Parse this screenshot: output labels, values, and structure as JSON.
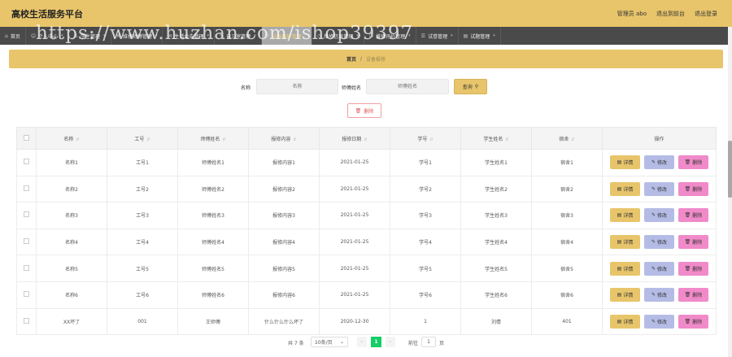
{
  "header": {
    "title": "高校生活服务平台",
    "admin": "管理员 abo",
    "back_home": "退出到前台",
    "logout": "退出登录"
  },
  "nav": [
    {
      "icon": "home-icon",
      "label": "首页",
      "active": false
    },
    {
      "icon": "user-icon",
      "label": "个人中心",
      "active": false
    },
    {
      "icon": "student-icon",
      "label": "学生管理",
      "active": false
    },
    {
      "icon": "worker-icon",
      "label": "维修师傅管理",
      "active": false
    },
    {
      "icon": "notice-icon",
      "label": "生活公告管理",
      "active": false
    },
    {
      "icon": "post-icon",
      "label": "自习室管理",
      "active": false
    },
    {
      "icon": "mic-icon",
      "label": "设备报修管理",
      "active": true
    },
    {
      "icon": "clock-icon",
      "label": "维修信息管理",
      "active": false
    },
    {
      "icon": "comment-icon",
      "label": "维修评价管理",
      "active": false
    },
    {
      "icon": "exam-icon",
      "label": "试卷管理",
      "active": false
    },
    {
      "icon": "test-icon",
      "label": "试题管理",
      "active": false
    }
  ],
  "watermark": "https://www.huzhan.com/ishop39397",
  "breadcrumb": {
    "home": "首页",
    "sep": "/",
    "current": "设备报修"
  },
  "search": {
    "name_label": "名称",
    "name_placeholder": "名称",
    "worker_label": "师傅姓名",
    "worker_placeholder": "师傅姓名",
    "query_label": "查询"
  },
  "delete_label": "删除",
  "table": {
    "headers": [
      "名称",
      "工号",
      "师傅姓名",
      "报修内容",
      "报修日期",
      "学号",
      "学生姓名",
      "宿舍",
      "操作"
    ],
    "rows": [
      [
        "名称1",
        "工号1",
        "师傅姓名1",
        "报修内容1",
        "2021-01-25",
        "学号1",
        "学生姓名1",
        "宿舍1"
      ],
      [
        "名称2",
        "工号2",
        "师傅姓名2",
        "报修内容2",
        "2021-01-25",
        "学号2",
        "学生姓名2",
        "宿舍2"
      ],
      [
        "名称3",
        "工号3",
        "师傅姓名3",
        "报修内容3",
        "2021-01-25",
        "学号3",
        "学生姓名3",
        "宿舍3"
      ],
      [
        "名称4",
        "工号4",
        "师傅姓名4",
        "报修内容4",
        "2021-01-25",
        "学号4",
        "学生姓名4",
        "宿舍4"
      ],
      [
        "名称5",
        "工号5",
        "师傅姓名5",
        "报修内容5",
        "2021-01-25",
        "学号5",
        "学生姓名5",
        "宿舍5"
      ],
      [
        "名称6",
        "工号6",
        "师傅姓名6",
        "报修内容6",
        "2021-01-25",
        "学号6",
        "学生姓名6",
        "宿舍6"
      ],
      [
        "XX坏了",
        "001",
        "王师傅",
        "什么什么什么坏了",
        "2020-12-30",
        "1",
        "刘倩",
        "401"
      ]
    ],
    "actions": {
      "detail": "详情",
      "edit": "修改",
      "remove": "删除"
    }
  },
  "pagination": {
    "total": "共 7 条",
    "page_size": "10条/页",
    "current_page": "1",
    "goto_label": "前往",
    "jump_value": "1",
    "page_suffix": "页"
  },
  "colors": {
    "accent": "#e8c56b",
    "nav_bg": "#4a4a4a",
    "edit": "#b4bce6",
    "remove": "#f08ac8",
    "current_page": "#13ce66"
  }
}
